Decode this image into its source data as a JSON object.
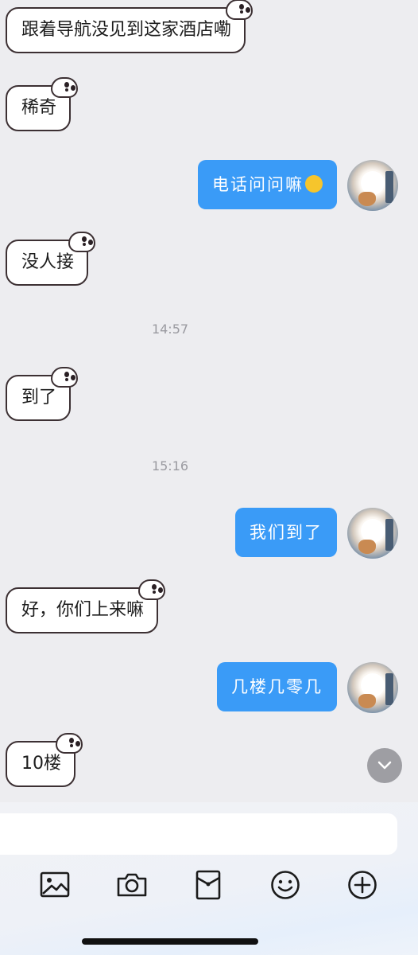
{
  "messages": {
    "m1": "跟着导航没见到这家酒店嘞",
    "m2": "稀奇",
    "m3": "电话问问嘛",
    "m4": "没人接",
    "t1": "14:57",
    "m5": "到了",
    "t2": "15:16",
    "m6": "我们到了",
    "m7": "好，你们上来嘛",
    "m8": "几楼几零几",
    "m9": "10楼"
  },
  "icons": {
    "emoji": "crying-face-emoji",
    "scroll": "chevron-down-icon",
    "toolbar": [
      "image-icon",
      "camera-icon",
      "red-packet-icon",
      "emoji-icon",
      "plus-icon"
    ]
  },
  "colors": {
    "background": "#ededf0",
    "outgoing_bubble": "#3a9bf7",
    "incoming_bubble": "#ffffff",
    "bubble_outline": "#3c3033"
  }
}
